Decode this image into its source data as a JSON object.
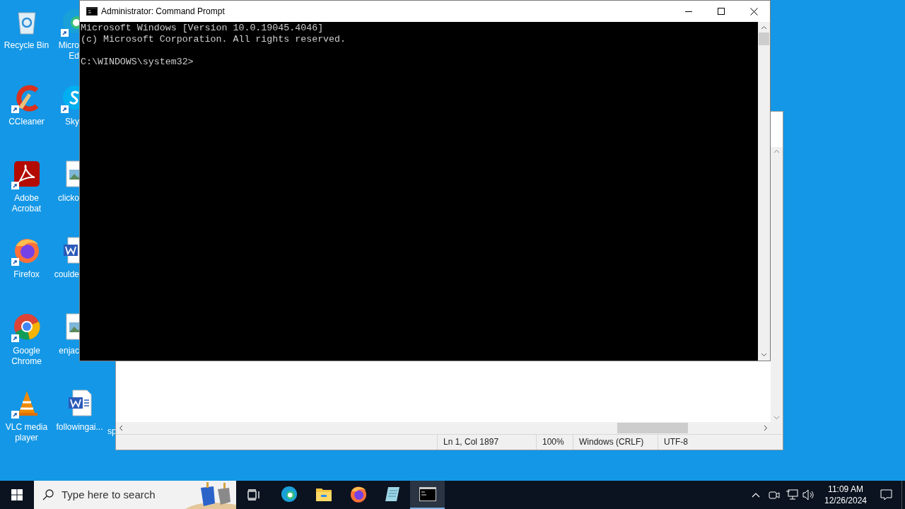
{
  "desktop": {
    "column_1": [
      {
        "label": "Recycle Bin",
        "shortcut": false
      },
      {
        "label": "CCleaner",
        "shortcut": true
      },
      {
        "label": "Adobe Acrobat",
        "shortcut": true
      },
      {
        "label": "Firefox",
        "shortcut": true
      },
      {
        "label": "Google Chrome",
        "shortcut": true
      },
      {
        "label": "VLC media player",
        "shortcut": true
      }
    ],
    "column_2": [
      {
        "label_lines": [
          "Micro",
          "Ed"
        ],
        "shortcut": true
      },
      {
        "label_lines": [
          "Sky"
        ],
        "shortcut": true
      },
      {
        "label_lines": [
          "clicko"
        ],
        "shortcut": false
      },
      {
        "label_lines": [
          "coulde"
        ],
        "shortcut": false
      },
      {
        "label_lines": [
          "enjac"
        ],
        "shortcut": false
      }
    ],
    "bottom_row": [
      {
        "label": "followingai...",
        "shortcut": false
      }
    ],
    "column_3": [
      {
        "label": "sp"
      }
    ]
  },
  "notepad": {
    "status_bar": [
      "Ln 1, Col 1897",
      "100%",
      "Windows (CRLF)",
      "UTF-8"
    ]
  },
  "cmd": {
    "title": "Administrator: Command Prompt",
    "output": [
      "Microsoft Windows [Version 10.0.19045.4046]",
      "(c) Microsoft Corporation. All rights reserved."
    ],
    "prompt": "C:\\WINDOWS\\system32>"
  },
  "taskbar": {
    "search": {
      "placeholder": "Type here to search"
    },
    "apps": [
      {
        "kind": "edge",
        "selected": false
      },
      {
        "kind": "explorer",
        "selected": false
      },
      {
        "kind": "firefox",
        "selected": false
      },
      {
        "kind": "notepad",
        "selected": false
      },
      {
        "kind": "cmd",
        "selected": true
      }
    ],
    "time": "11:09 AM",
    "date": "12/26/2024"
  }
}
